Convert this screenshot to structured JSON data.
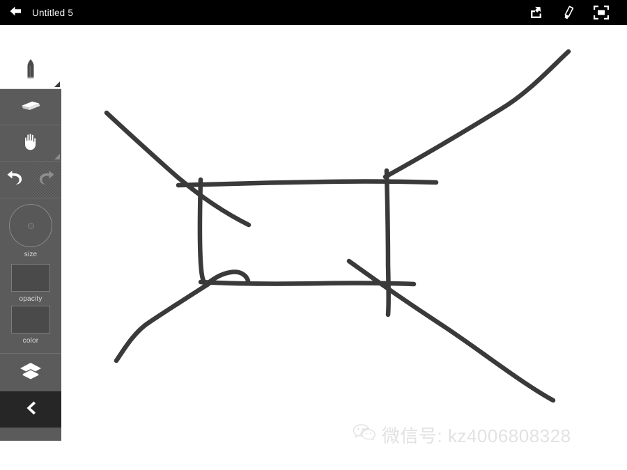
{
  "topbar": {
    "back_icon": "back-arrow-icon",
    "title": "Untitled 5",
    "actions": [
      {
        "name": "share-icon",
        "label": "Share"
      },
      {
        "name": "brush-icon",
        "label": "Brush"
      },
      {
        "name": "fullscreen-icon",
        "label": "Fullscreen"
      }
    ],
    "background_color": "#000000",
    "text_color": "#f2f2f2"
  },
  "toolbar": {
    "background_color": "#5b5b5b",
    "tools": [
      {
        "name": "pencil-tool",
        "label": "Pencil",
        "icon": "pencil-icon",
        "active": true
      },
      {
        "name": "eraser-tool",
        "label": "Eraser",
        "icon": "eraser-icon",
        "active": false
      },
      {
        "name": "pan-tool",
        "label": "Pan",
        "icon": "hand-icon",
        "active": false
      }
    ],
    "undo": {
      "label": "Undo",
      "icon": "undo-arrow-icon",
      "enabled": true
    },
    "redo": {
      "label": "Redo",
      "icon": "redo-arrow-icon",
      "enabled": false
    },
    "size": {
      "label": "size",
      "icon": "size-dial-icon"
    },
    "opacity": {
      "label": "opacity",
      "swatch_color": "#4a4a4a"
    },
    "color": {
      "label": "color",
      "swatch_color": "#4a4a4a"
    },
    "layers": {
      "label": "Layers",
      "icon": "layers-icon"
    },
    "collapse": {
      "label": "Collapse",
      "icon": "chevron-left-icon"
    }
  },
  "canvas": {
    "background_color": "#ffffff",
    "stroke_color": "#3a3a3a",
    "stroke_width": 6
  },
  "watermark": {
    "icon": "wechat-icon",
    "text": "微信号: kz4006808328",
    "color": "#e2e2e2"
  }
}
